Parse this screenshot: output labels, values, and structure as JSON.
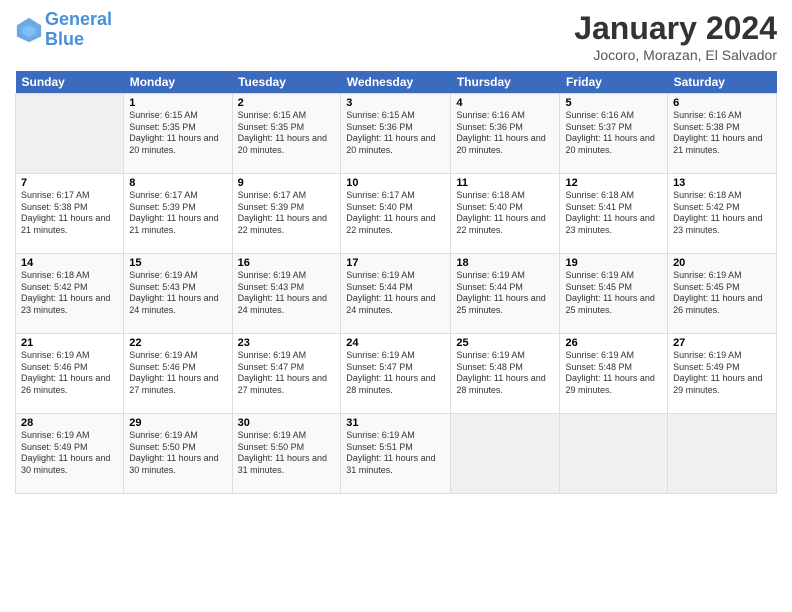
{
  "header": {
    "logo_line1": "General",
    "logo_line2": "Blue",
    "title": "January 2024",
    "subtitle": "Jocoro, Morazan, El Salvador"
  },
  "days_of_week": [
    "Sunday",
    "Monday",
    "Tuesday",
    "Wednesday",
    "Thursday",
    "Friday",
    "Saturday"
  ],
  "weeks": [
    [
      {
        "num": "",
        "sunrise": "",
        "sunset": "",
        "daylight": ""
      },
      {
        "num": "1",
        "sunrise": "Sunrise: 6:15 AM",
        "sunset": "Sunset: 5:35 PM",
        "daylight": "Daylight: 11 hours and 20 minutes."
      },
      {
        "num": "2",
        "sunrise": "Sunrise: 6:15 AM",
        "sunset": "Sunset: 5:35 PM",
        "daylight": "Daylight: 11 hours and 20 minutes."
      },
      {
        "num": "3",
        "sunrise": "Sunrise: 6:15 AM",
        "sunset": "Sunset: 5:36 PM",
        "daylight": "Daylight: 11 hours and 20 minutes."
      },
      {
        "num": "4",
        "sunrise": "Sunrise: 6:16 AM",
        "sunset": "Sunset: 5:36 PM",
        "daylight": "Daylight: 11 hours and 20 minutes."
      },
      {
        "num": "5",
        "sunrise": "Sunrise: 6:16 AM",
        "sunset": "Sunset: 5:37 PM",
        "daylight": "Daylight: 11 hours and 20 minutes."
      },
      {
        "num": "6",
        "sunrise": "Sunrise: 6:16 AM",
        "sunset": "Sunset: 5:38 PM",
        "daylight": "Daylight: 11 hours and 21 minutes."
      }
    ],
    [
      {
        "num": "7",
        "sunrise": "Sunrise: 6:17 AM",
        "sunset": "Sunset: 5:38 PM",
        "daylight": "Daylight: 11 hours and 21 minutes."
      },
      {
        "num": "8",
        "sunrise": "Sunrise: 6:17 AM",
        "sunset": "Sunset: 5:39 PM",
        "daylight": "Daylight: 11 hours and 21 minutes."
      },
      {
        "num": "9",
        "sunrise": "Sunrise: 6:17 AM",
        "sunset": "Sunset: 5:39 PM",
        "daylight": "Daylight: 11 hours and 22 minutes."
      },
      {
        "num": "10",
        "sunrise": "Sunrise: 6:17 AM",
        "sunset": "Sunset: 5:40 PM",
        "daylight": "Daylight: 11 hours and 22 minutes."
      },
      {
        "num": "11",
        "sunrise": "Sunrise: 6:18 AM",
        "sunset": "Sunset: 5:40 PM",
        "daylight": "Daylight: 11 hours and 22 minutes."
      },
      {
        "num": "12",
        "sunrise": "Sunrise: 6:18 AM",
        "sunset": "Sunset: 5:41 PM",
        "daylight": "Daylight: 11 hours and 23 minutes."
      },
      {
        "num": "13",
        "sunrise": "Sunrise: 6:18 AM",
        "sunset": "Sunset: 5:42 PM",
        "daylight": "Daylight: 11 hours and 23 minutes."
      }
    ],
    [
      {
        "num": "14",
        "sunrise": "Sunrise: 6:18 AM",
        "sunset": "Sunset: 5:42 PM",
        "daylight": "Daylight: 11 hours and 23 minutes."
      },
      {
        "num": "15",
        "sunrise": "Sunrise: 6:19 AM",
        "sunset": "Sunset: 5:43 PM",
        "daylight": "Daylight: 11 hours and 24 minutes."
      },
      {
        "num": "16",
        "sunrise": "Sunrise: 6:19 AM",
        "sunset": "Sunset: 5:43 PM",
        "daylight": "Daylight: 11 hours and 24 minutes."
      },
      {
        "num": "17",
        "sunrise": "Sunrise: 6:19 AM",
        "sunset": "Sunset: 5:44 PM",
        "daylight": "Daylight: 11 hours and 24 minutes."
      },
      {
        "num": "18",
        "sunrise": "Sunrise: 6:19 AM",
        "sunset": "Sunset: 5:44 PM",
        "daylight": "Daylight: 11 hours and 25 minutes."
      },
      {
        "num": "19",
        "sunrise": "Sunrise: 6:19 AM",
        "sunset": "Sunset: 5:45 PM",
        "daylight": "Daylight: 11 hours and 25 minutes."
      },
      {
        "num": "20",
        "sunrise": "Sunrise: 6:19 AM",
        "sunset": "Sunset: 5:45 PM",
        "daylight": "Daylight: 11 hours and 26 minutes."
      }
    ],
    [
      {
        "num": "21",
        "sunrise": "Sunrise: 6:19 AM",
        "sunset": "Sunset: 5:46 PM",
        "daylight": "Daylight: 11 hours and 26 minutes."
      },
      {
        "num": "22",
        "sunrise": "Sunrise: 6:19 AM",
        "sunset": "Sunset: 5:46 PM",
        "daylight": "Daylight: 11 hours and 27 minutes."
      },
      {
        "num": "23",
        "sunrise": "Sunrise: 6:19 AM",
        "sunset": "Sunset: 5:47 PM",
        "daylight": "Daylight: 11 hours and 27 minutes."
      },
      {
        "num": "24",
        "sunrise": "Sunrise: 6:19 AM",
        "sunset": "Sunset: 5:47 PM",
        "daylight": "Daylight: 11 hours and 28 minutes."
      },
      {
        "num": "25",
        "sunrise": "Sunrise: 6:19 AM",
        "sunset": "Sunset: 5:48 PM",
        "daylight": "Daylight: 11 hours and 28 minutes."
      },
      {
        "num": "26",
        "sunrise": "Sunrise: 6:19 AM",
        "sunset": "Sunset: 5:48 PM",
        "daylight": "Daylight: 11 hours and 29 minutes."
      },
      {
        "num": "27",
        "sunrise": "Sunrise: 6:19 AM",
        "sunset": "Sunset: 5:49 PM",
        "daylight": "Daylight: 11 hours and 29 minutes."
      }
    ],
    [
      {
        "num": "28",
        "sunrise": "Sunrise: 6:19 AM",
        "sunset": "Sunset: 5:49 PM",
        "daylight": "Daylight: 11 hours and 30 minutes."
      },
      {
        "num": "29",
        "sunrise": "Sunrise: 6:19 AM",
        "sunset": "Sunset: 5:50 PM",
        "daylight": "Daylight: 11 hours and 30 minutes."
      },
      {
        "num": "30",
        "sunrise": "Sunrise: 6:19 AM",
        "sunset": "Sunset: 5:50 PM",
        "daylight": "Daylight: 11 hours and 31 minutes."
      },
      {
        "num": "31",
        "sunrise": "Sunrise: 6:19 AM",
        "sunset": "Sunset: 5:51 PM",
        "daylight": "Daylight: 11 hours and 31 minutes."
      },
      {
        "num": "",
        "sunrise": "",
        "sunset": "",
        "daylight": ""
      },
      {
        "num": "",
        "sunrise": "",
        "sunset": "",
        "daylight": ""
      },
      {
        "num": "",
        "sunrise": "",
        "sunset": "",
        "daylight": ""
      }
    ]
  ]
}
